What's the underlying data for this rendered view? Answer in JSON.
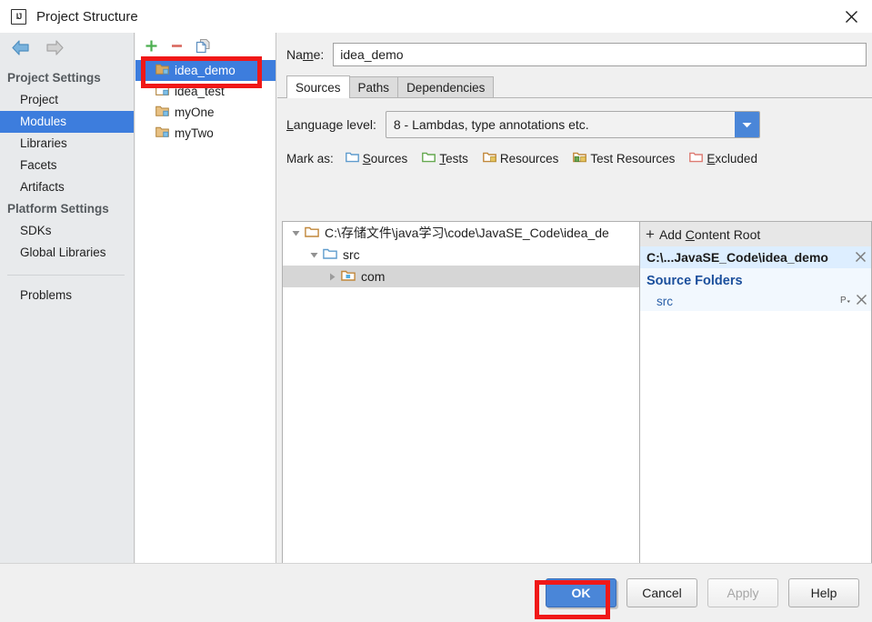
{
  "window": {
    "title": "Project Structure",
    "app_icon": "intellij-idea-icon",
    "close_label": "✕"
  },
  "sidebar": {
    "nav": {
      "back_icon": "back-arrow-icon",
      "forward_icon": "forward-arrow-icon"
    },
    "groups": [
      {
        "header": "Project Settings",
        "items": [
          {
            "label": "Project",
            "selected": false
          },
          {
            "label": "Modules",
            "selected": true
          },
          {
            "label": "Libraries",
            "selected": false
          },
          {
            "label": "Facets",
            "selected": false
          },
          {
            "label": "Artifacts",
            "selected": false
          }
        ]
      },
      {
        "header": "Platform Settings",
        "items": [
          {
            "label": "SDKs",
            "selected": false
          },
          {
            "label": "Global Libraries",
            "selected": false
          }
        ]
      }
    ],
    "problems": {
      "label": "Problems"
    }
  },
  "modules_panel": {
    "toolbar": {
      "add_icon": "plus-icon",
      "remove_icon": "minus-icon",
      "copy_icon": "copy-icon"
    },
    "modules": [
      {
        "label": "idea_demo",
        "selected": true
      },
      {
        "label": "idea_test",
        "selected": false
      },
      {
        "label": "myOne",
        "selected": false
      },
      {
        "label": "myTwo",
        "selected": false
      }
    ]
  },
  "module_editor": {
    "name_label": "Name:",
    "name_value": "idea_demo",
    "tabs": [
      {
        "label": "Sources",
        "active": true
      },
      {
        "label": "Paths",
        "active": false
      },
      {
        "label": "Dependencies",
        "active": false
      }
    ],
    "language_level": {
      "label": "Language level:",
      "value": "8 - Lambdas, type annotations etc.",
      "arrow_icon": "chevron-down-icon"
    },
    "mark_as": {
      "label": "Mark as:",
      "options": [
        {
          "label": "Sources",
          "icon": "folder-blue-icon",
          "accent": "#6fa8dc"
        },
        {
          "label": "Tests",
          "icon": "folder-green-icon",
          "accent": "#6aa84f"
        },
        {
          "label": "Resources",
          "icon": "folder-resources-icon",
          "accent": "#c9893a"
        },
        {
          "label": "Test Resources",
          "icon": "folder-test-resources-icon",
          "accent": "#c9893a"
        },
        {
          "label": "Excluded",
          "icon": "folder-red-icon",
          "accent": "#e06666"
        }
      ]
    },
    "tree": {
      "rows": [
        {
          "label": "C:\\存储文件\\java学习\\code\\JavaSE_Code\\idea_de",
          "depth": 0,
          "twisty": "expanded",
          "icon": "folder-content-root-icon",
          "selected": false
        },
        {
          "label": "src",
          "depth": 1,
          "twisty": "expanded",
          "icon": "folder-sources-icon",
          "selected": false
        },
        {
          "label": "com",
          "depth": 2,
          "twisty": "collapsed",
          "icon": "folder-package-icon",
          "selected": true
        }
      ]
    },
    "content_roots": {
      "add_label": "Add Content Root",
      "add_icon": "plus-icon",
      "entries": [
        {
          "path": "C:\\...JavaSE_Code\\idea_demo",
          "remove_icon": "close-icon",
          "section_title": "Source Folders",
          "folders": [
            {
              "name": "src",
              "package_prefix_icon": "package-prefix-icon",
              "remove_icon": "close-icon"
            }
          ]
        }
      ]
    }
  },
  "footer": {
    "buttons": [
      {
        "label": "OK",
        "style": "primary",
        "enabled": true
      },
      {
        "label": "Cancel",
        "style": "default",
        "enabled": true
      },
      {
        "label": "Apply",
        "style": "default",
        "enabled": false
      },
      {
        "label": "Help",
        "style": "default",
        "enabled": true
      }
    ]
  },
  "annotations": {
    "highlight_color": "#f01818",
    "boxes": [
      {
        "target": "module-idea_demo"
      },
      {
        "target": "ok-button"
      }
    ]
  }
}
